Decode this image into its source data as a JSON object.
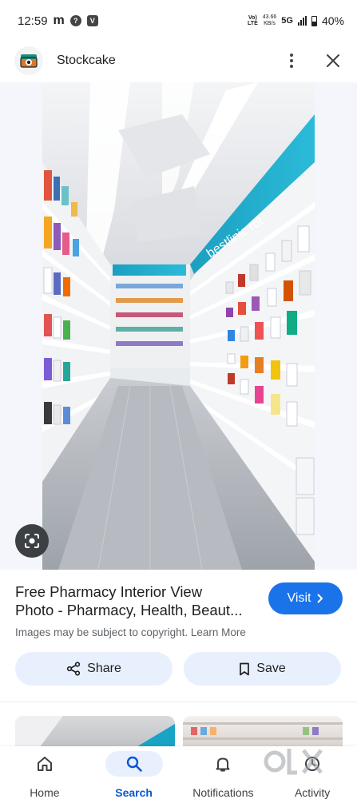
{
  "status_bar": {
    "time": "12:59",
    "carrier_icon": "m",
    "volte_top": "Vo)",
    "volte_bottom": "LTE",
    "speed_top": "43.66",
    "speed_bottom": "KB/s",
    "network": "5G",
    "battery": "40%"
  },
  "header": {
    "site_name": "Stockcake",
    "logo_icon": "stockcake-logo-icon",
    "menu_icon": "more-vert-icon",
    "close_icon": "close-icon"
  },
  "image": {
    "subject": "pharmacy aisle with white shelves and teal sign",
    "lens_icon": "lens-icon"
  },
  "result": {
    "title_line1": "Free Pharmacy Interior View",
    "title_line2": "Photo - Pharmacy, Health, Beaut...",
    "copyright": "Images may be subject to copyright.",
    "learn_more": "Learn More",
    "visit_label": "Visit"
  },
  "actions": {
    "share_label": "Share",
    "save_label": "Save"
  },
  "nav": {
    "items": [
      {
        "label": "Home",
        "icon": "home-icon"
      },
      {
        "label": "Search",
        "icon": "search-icon"
      },
      {
        "label": "Notifications",
        "icon": "bell-icon"
      },
      {
        "label": "Activity",
        "icon": "activity-icon"
      }
    ]
  },
  "colors": {
    "accent": "#1a73e8",
    "button_bg": "#e8f0fe",
    "active_nav": "#0b57d0",
    "sign_teal": "#19a3c4"
  }
}
